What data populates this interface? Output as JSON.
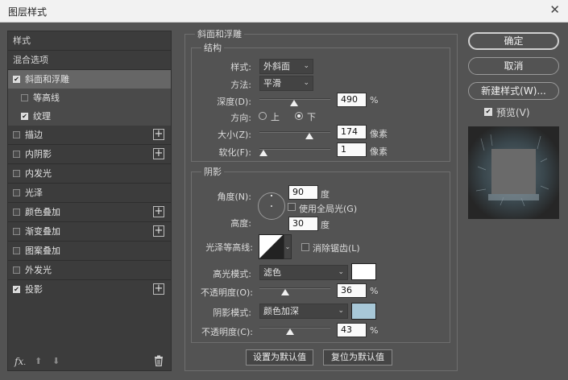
{
  "window": {
    "title": "图层样式",
    "close_label": "✕"
  },
  "sidebar": {
    "header": "样式",
    "blend": "混合选项",
    "items": [
      {
        "label": "斜面和浮雕",
        "checked": true
      },
      {
        "label": "等高线",
        "checked": false
      },
      {
        "label": "纹理",
        "checked": true
      },
      {
        "label": "描边",
        "checked": false
      },
      {
        "label": "内阴影",
        "checked": false
      },
      {
        "label": "内发光",
        "checked": false
      },
      {
        "label": "光泽",
        "checked": false
      },
      {
        "label": "颜色叠加",
        "checked": false
      },
      {
        "label": "渐变叠加",
        "checked": false
      },
      {
        "label": "图案叠加",
        "checked": false
      },
      {
        "label": "外发光",
        "checked": false
      },
      {
        "label": "投影",
        "checked": true
      }
    ],
    "fx_label": "fx",
    "fx_dot": "."
  },
  "bevel": {
    "section_title": "斜面和浮雕",
    "structure_title": "结构",
    "style_label": "样式:",
    "style_value": "外斜面",
    "method_label": "方法:",
    "method_value": "平滑",
    "depth_label": "深度(D):",
    "depth_value": "490",
    "depth_unit": "%",
    "depth_slider": 0.49,
    "direction_label": "方向:",
    "dir_up": "上",
    "dir_down": "下",
    "size_label": "大小(Z):",
    "size_value": "174",
    "size_unit": "像素",
    "size_slider": 0.7,
    "soften_label": "软化(F):",
    "soften_value": "1",
    "soften_unit": "像素",
    "soften_slider": 0.06
  },
  "shading": {
    "title": "阴影",
    "angle_label": "角度(N):",
    "angle_value": "90",
    "angle_unit": "度",
    "global_light_label": "使用全局光(G)",
    "altitude_label": "高度:",
    "altitude_value": "30",
    "altitude_unit": "度",
    "gloss_label": "光泽等高线:",
    "antialias_label": "消除锯齿(L)",
    "highlight_mode_label": "高光模式:",
    "highlight_mode_value": "滤色",
    "highlight_color": "#ffffff",
    "highlight_opacity_label": "不透明度(O):",
    "highlight_opacity_value": "36",
    "highlight_opacity_unit": "%",
    "highlight_opacity_slider": 0.36,
    "shadow_mode_label": "阴影模式:",
    "shadow_mode_value": "颜色加深",
    "shadow_color": "#a8c8d8",
    "shadow_opacity_label": "不透明度(C):",
    "shadow_opacity_value": "43",
    "shadow_opacity_unit": "%",
    "shadow_opacity_slider": 0.43
  },
  "footer": {
    "make_default": "设置为默认值",
    "reset_default": "复位为默认值"
  },
  "actions": {
    "ok": "确定",
    "cancel": "取消",
    "new_style": "新建样式(W)...",
    "preview": "预览(V)"
  }
}
